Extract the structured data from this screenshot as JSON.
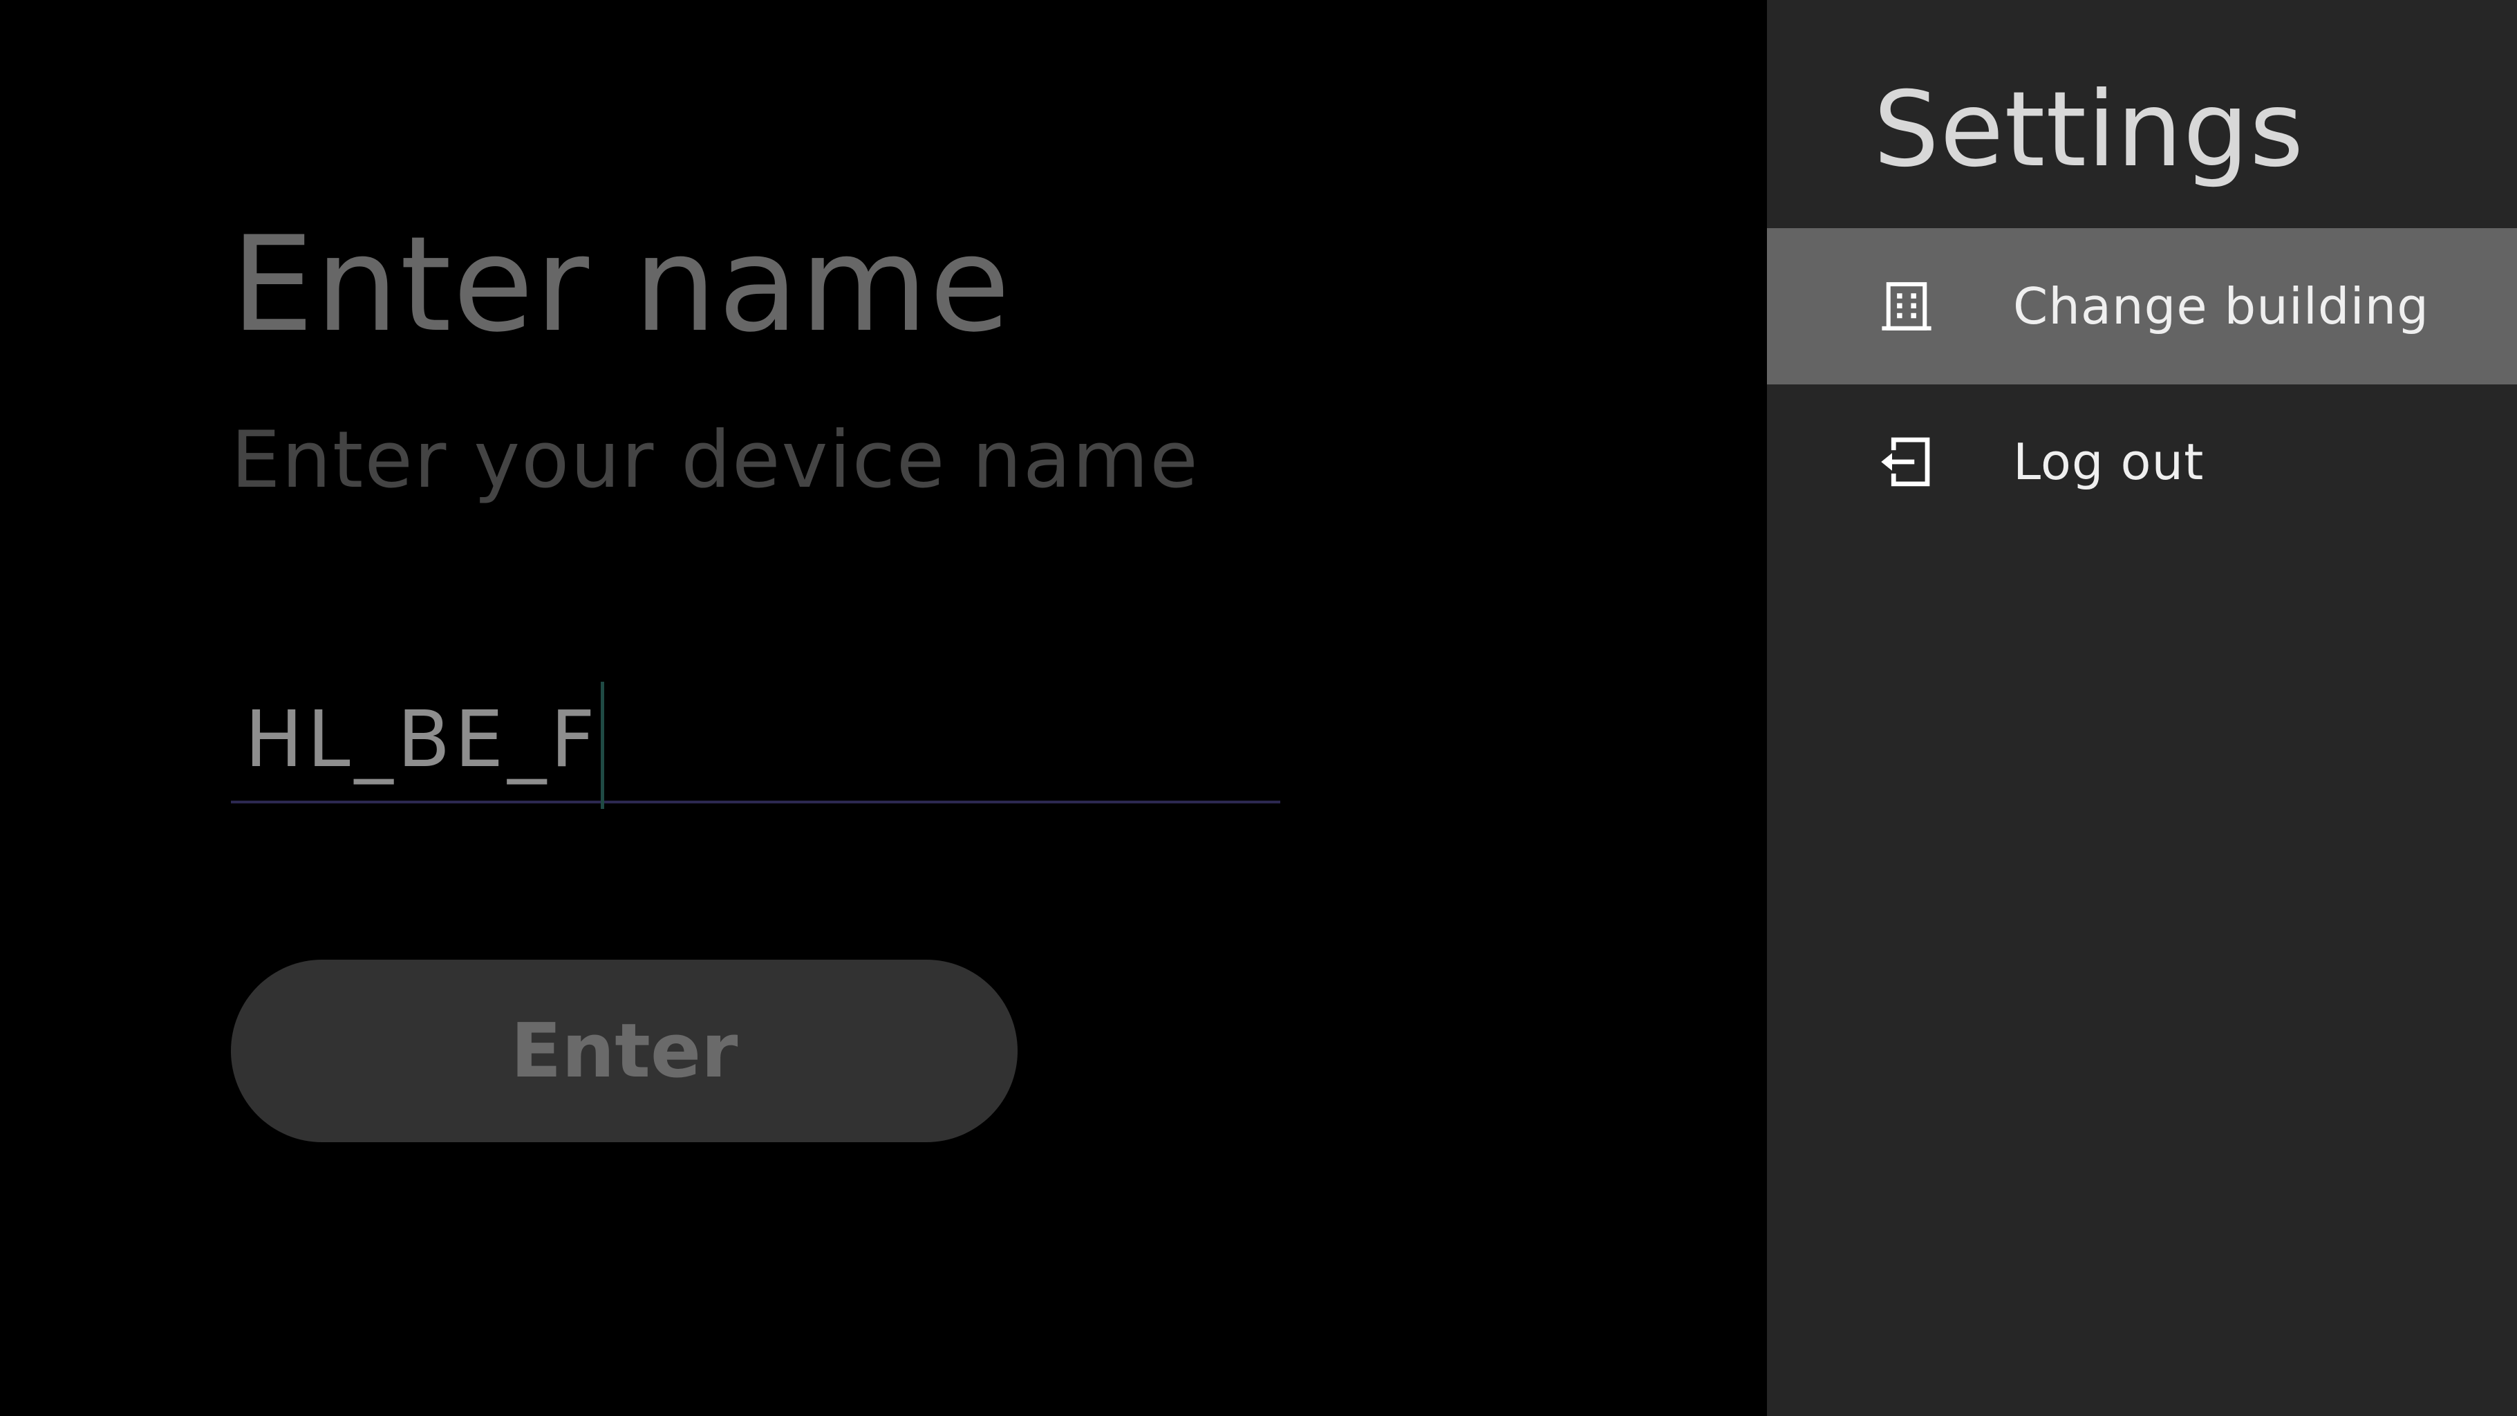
{
  "main": {
    "title": "Enter name",
    "subtitle": "Enter your device name",
    "name_input": {
      "value": "HL_BE_F"
    },
    "enter_label": "Enter"
  },
  "settings": {
    "title": "Settings",
    "items": [
      {
        "label": "Change building",
        "icon": "building-icon",
        "selected": true
      },
      {
        "label": "Log out",
        "icon": "logout-icon",
        "selected": false
      }
    ]
  },
  "colors": {
    "background": "#000000",
    "drawer_background": "#262626",
    "selected_item": "#646464",
    "button_background": "#323232",
    "input_underline": "#2c2850",
    "caret": "#1f4a44"
  }
}
